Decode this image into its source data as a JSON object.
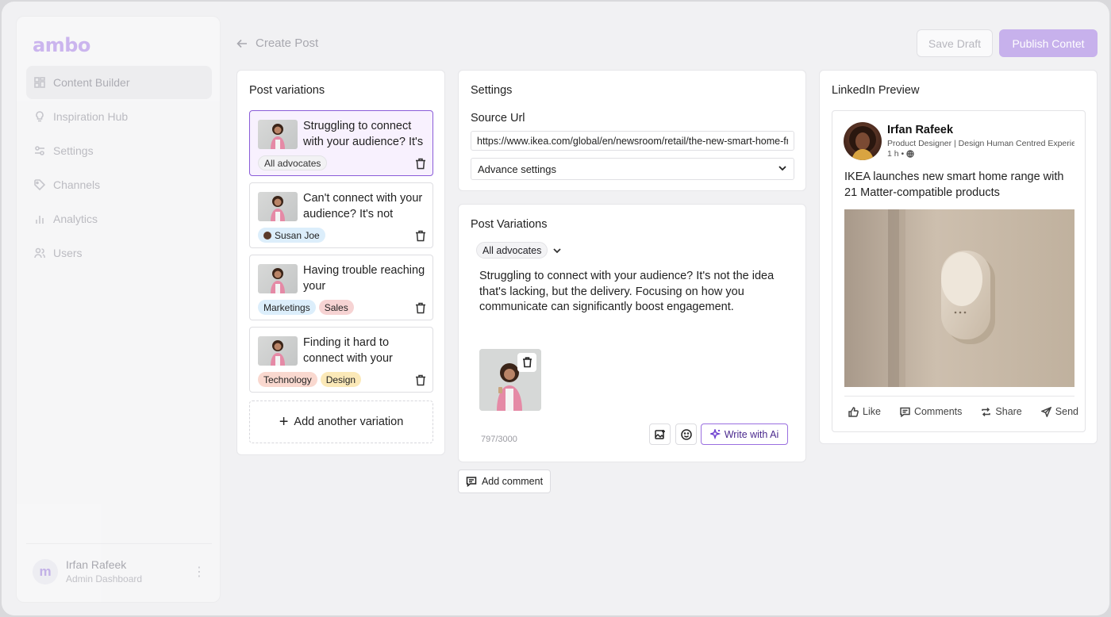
{
  "app": {
    "logo": "ambo"
  },
  "sidebar": {
    "items": [
      {
        "label": "Content Builder",
        "icon": "grid-icon",
        "active": true
      },
      {
        "label": "Inspiration Hub",
        "icon": "bulb-icon"
      },
      {
        "label": "Settings",
        "icon": "sliders-icon"
      },
      {
        "label": "Channels",
        "icon": "tag-icon"
      },
      {
        "label": "Analytics",
        "icon": "bar-chart-icon"
      },
      {
        "label": "Users",
        "icon": "users-icon"
      }
    ],
    "footer": {
      "avatar_letter": "m",
      "name": "Irfan Rafeek",
      "role": "Admin Dashboard"
    }
  },
  "header": {
    "back_label": "Create Post",
    "save_draft": "Save Draft",
    "publish": "Publish Contet"
  },
  "variations_panel": {
    "title": "Post variations",
    "items": [
      {
        "text": "Struggling to connect with your audience? It's",
        "tags": [
          "All advocates"
        ]
      },
      {
        "text": "Can't connect with your audience? It's not",
        "tags": [
          "Susan Joe"
        ]
      },
      {
        "text": "Having trouble reaching your",
        "tags": [
          "Marketings",
          "Sales"
        ]
      },
      {
        "text": "Finding it hard to connect with your",
        "tags": [
          "Technology",
          "Design"
        ]
      }
    ],
    "add_label": "Add another variation"
  },
  "settings_panel": {
    "title": "Settings",
    "source_label": "Source Url",
    "source_value": "https://www.ikea.com/global/en/newsroom/retail/the-new-smart-home-from-ikea",
    "advanced_label": "Advance settings"
  },
  "editor": {
    "title": "Post Variations",
    "audience": "All advocates",
    "body": "Struggling to connect with your audience? It's not the idea that's lacking, but the delivery. Focusing on how you communicate can significantly boost engagement.",
    "counter": "797/3000",
    "write_ai": "Write with Ai",
    "add_comment": "Add comment"
  },
  "preview": {
    "title": "LinkedIn Preview",
    "name": "Irfan Rafeek",
    "headline": "Product Designer | Design Human Centred Experiences",
    "time": "1 h •",
    "text": "IKEA launches new smart home range with 21 Matter-compatible products",
    "actions": {
      "like": "Like",
      "comments": "Comments",
      "share": "Share",
      "send": "Send"
    }
  },
  "colors": {
    "accent": "#8a5cd8",
    "publish_bg": "#c7b1ec",
    "selected_bg": "#f8f1fe"
  }
}
